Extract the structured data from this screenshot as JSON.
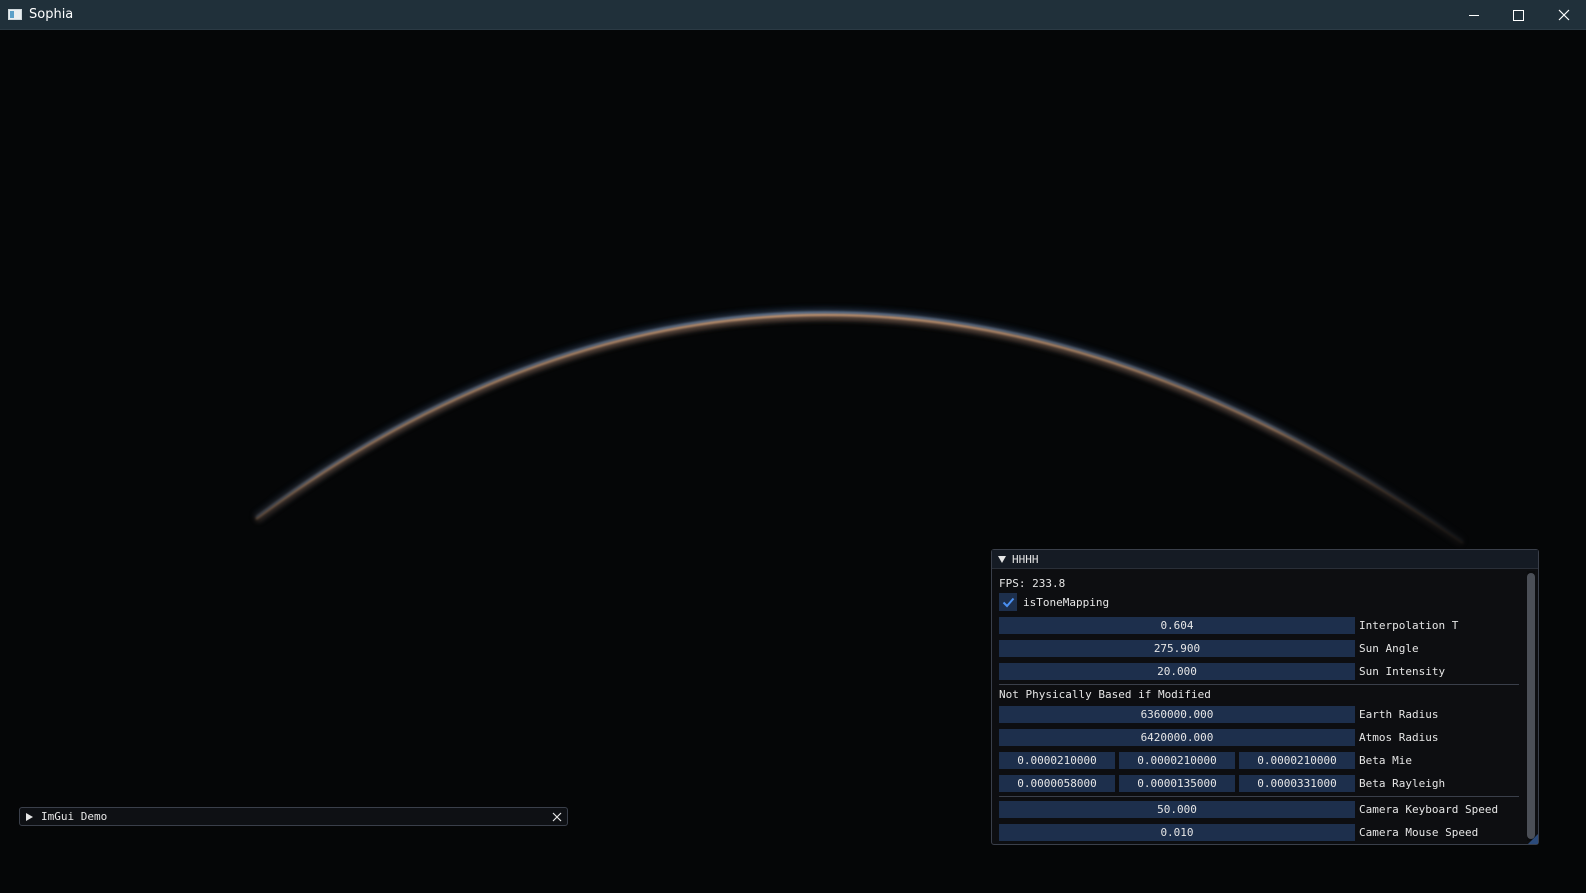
{
  "window": {
    "title": "Sophia",
    "icon": "app-window-icon",
    "controls": [
      "minimize-icon",
      "maximize-icon",
      "close-icon"
    ]
  },
  "scene": {
    "description_icon": "atmosphere-horizon-arc",
    "colors": {
      "background": "#050607",
      "rim_orange": "#ffb27a",
      "rim_blue": "#5f8fc8"
    }
  },
  "demo_window": {
    "title": "ImGui Demo",
    "collapsed": true
  },
  "panel": {
    "title": "HHHH",
    "fps_text": "FPS: 233.8",
    "tone_mapping": {
      "label": "isToneMapping",
      "checked": true
    },
    "sliders": [
      {
        "value": "0.604",
        "label": "Interpolation T"
      },
      {
        "value": "275.900",
        "label": "Sun Angle"
      },
      {
        "value": "20.000",
        "label": "Sun Intensity"
      }
    ],
    "section_text": "Not Physically Based if Modified",
    "physics": [
      {
        "value": "6360000.000",
        "label": "Earth Radius"
      },
      {
        "value": "6420000.000",
        "label": "Atmos Radius"
      }
    ],
    "beta_mie": {
      "values": [
        "0.0000210000",
        "0.0000210000",
        "0.0000210000"
      ],
      "label": "Beta Mie"
    },
    "beta_rayleigh": {
      "values": [
        "0.0000058000",
        "0.0000135000",
        "0.0000331000"
      ],
      "label": "Beta Rayleigh"
    },
    "camera": [
      {
        "value": "50.000",
        "label": "Camera Keyboard Speed"
      },
      {
        "value": "0.010",
        "label": "Camera Mouse Speed"
      }
    ],
    "accent": "#1d2f4c"
  }
}
